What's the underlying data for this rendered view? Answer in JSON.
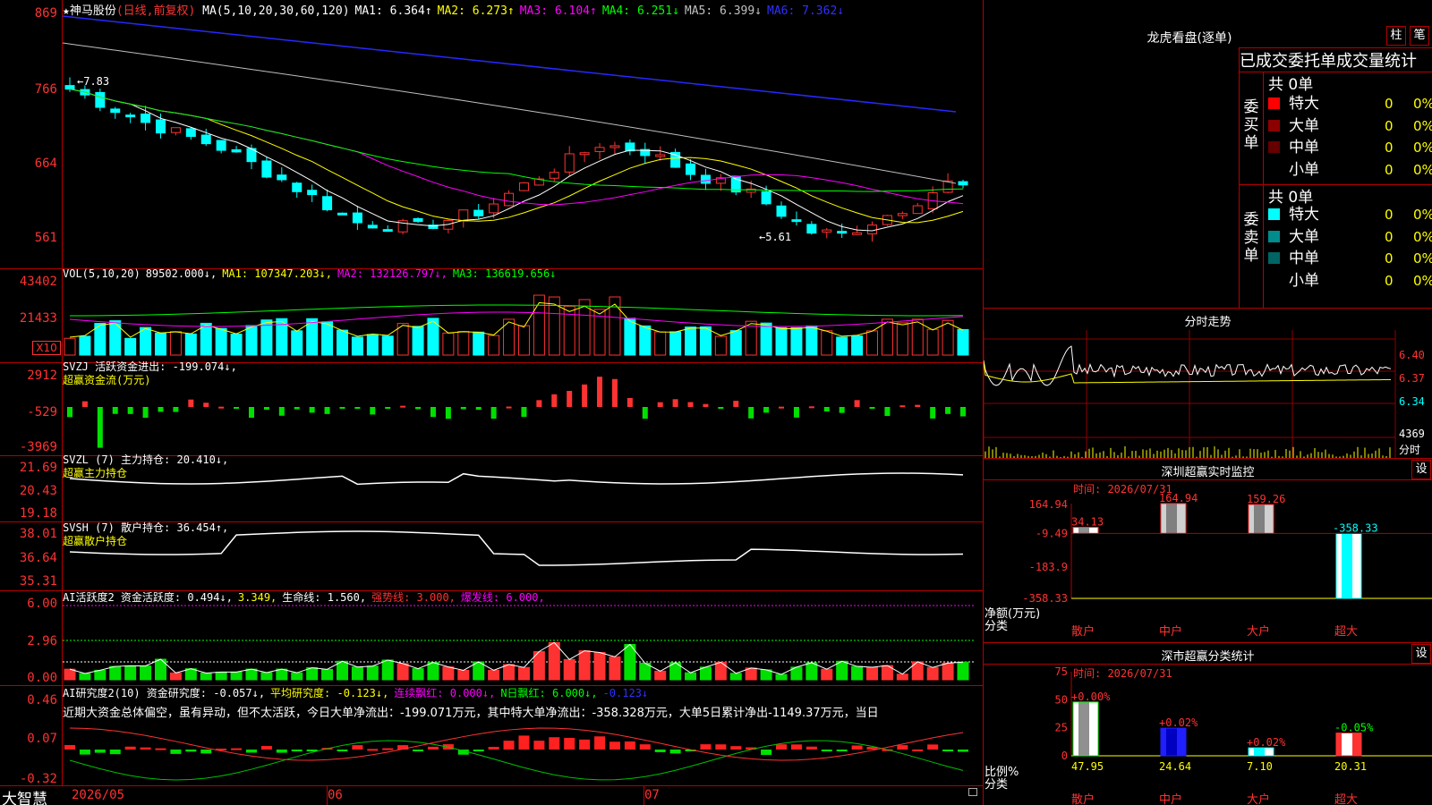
{
  "stock": {
    "star": "★",
    "name": "神马股份",
    "mode": "(日线,前复权)"
  },
  "ma_legend": [
    {
      "label": "MA(5,10,20,30,60,120)",
      "color": "#ffffff"
    },
    {
      "label": "MA1: 6.364↑",
      "color": "#ffffff"
    },
    {
      "label": "MA2: 6.273↑",
      "color": "#ffff00"
    },
    {
      "label": "MA3: 6.104↑",
      "color": "#ff00ff"
    },
    {
      "label": "MA4: 6.251↓",
      "color": "#00ff00"
    },
    {
      "label": "MA5: 6.399↓",
      "color": "#c0c0c0"
    },
    {
      "label": "MA6: 7.362↓",
      "color": "#3030ff"
    }
  ],
  "price_axis": [
    "869",
    "766",
    "664",
    "561"
  ],
  "price_annotations": {
    "high": "7.83",
    "low": "5.61"
  },
  "vol_legend": [
    {
      "label": "VOL(5,10,20)",
      "color": "#ffffff"
    },
    {
      "label": "89502.000↓,",
      "color": "#ffffff"
    },
    {
      "label": "MA1: 107347.203↓,",
      "color": "#ffff00"
    },
    {
      "label": "MA2: 132126.797↓,",
      "color": "#ff00ff"
    },
    {
      "label": "MA3: 136619.656↓",
      "color": "#00ff00"
    }
  ],
  "vol_axis": [
    "43402",
    "21433"
  ],
  "vol_unit": "X10",
  "svzj_legend": {
    "line1": "SVZJ  活跃资金进出: -199.074↓,",
    "line2": "超赢资金流(万元)"
  },
  "svzj_axis": [
    "2912",
    "-529",
    "-3969"
  ],
  "svzl_legend": {
    "line1": "SVZL (7) 主力持仓: 20.410↓,",
    "line2": "超赢主力持仓"
  },
  "svzl_axis": [
    "21.69",
    "20.43",
    "19.18"
  ],
  "svsh_legend": {
    "line1": "SVSH (7) 散户持仓: 36.454↑,",
    "line2": "超赢散户持仓"
  },
  "svsh_axis": [
    "38.01",
    "36.64",
    "35.31"
  ],
  "ai1_legend": [
    {
      "label": "AI活跃度2 资金活跃度: 0.494↓,",
      "color": "#ffffff"
    },
    {
      "label": "3.349,",
      "color": "#ffff00"
    },
    {
      "label": "生命线: 1.560,",
      "color": "#ffffff"
    },
    {
      "label": "强势线: 3.000,",
      "color": "#ff3232"
    },
    {
      "label": "爆发线: 6.000,",
      "color": "#ff00ff"
    }
  ],
  "ai1_axis": [
    "6.00",
    "2.96",
    "0.00"
  ],
  "ai2_legend": [
    {
      "label": "AI研究度2(10) 资金研究度: -0.057↓,",
      "color": "#ffffff"
    },
    {
      "label": "平均研究度: -0.123↓,",
      "color": "#ffff00"
    },
    {
      "label": "连续飘红: 0.000↓,",
      "color": "#ff00ff"
    },
    {
      "label": "N日飘红: 6.000↓,",
      "color": "#00ff00"
    },
    {
      "label": "-0.123↓",
      "color": "#3030ff"
    }
  ],
  "ai2_text": "近期大资金总体偏空，虽有异动，但不太活跃，今日大单净流出：-199.071万元，其中特大单净流出：-358.328万元，大单5日累计净出-1149.37万元，当日",
  "ai2_axis": [
    "0.46",
    "0.07",
    "-0.32"
  ],
  "date_axis": {
    "brand": "大智慧",
    "labels": [
      "2026/05",
      "06",
      "07"
    ]
  },
  "longhu": {
    "title": "龙虎看盘(逐单)",
    "btn1": "柱",
    "btn2": "笔",
    "subtitle": "已成交委托单成交量统计",
    "buy": {
      "side": "委买单",
      "total": "共 0单",
      "rows": [
        {
          "label": "特大",
          "color": "#ff0000",
          "count": "0",
          "pct": "0%"
        },
        {
          "label": "大单",
          "color": "#8c0000",
          "count": "0",
          "pct": "0%"
        },
        {
          "label": "中单",
          "color": "#640000",
          "count": "0",
          "pct": "0%"
        },
        {
          "label": "小单",
          "color": "#000000",
          "count": "0",
          "pct": "0%"
        }
      ]
    },
    "sell": {
      "side": "委卖单",
      "total": "共 0单",
      "rows": [
        {
          "label": "特大",
          "color": "#00ffff",
          "count": "0",
          "pct": "0%"
        },
        {
          "label": "大单",
          "color": "#008c8c",
          "count": "0",
          "pct": "0%"
        },
        {
          "label": "中单",
          "color": "#006464",
          "count": "0",
          "pct": "0%"
        },
        {
          "label": "小单",
          "color": "#000000",
          "count": "0",
          "pct": "0%"
        }
      ]
    }
  },
  "intraday": {
    "title": "分时走势",
    "axis": [
      "6.40",
      "6.37",
      "6.34"
    ],
    "vol_label": "4369",
    "vol_caption": "分时"
  },
  "monitor": {
    "title": "深圳超赢实时监控",
    "btn": "设",
    "time": "时间: 2026/07/31",
    "axis": [
      "164.94",
      "-9.49",
      "-183.9",
      "-358.33"
    ],
    "caption1": "净额(万元)",
    "caption2": "分类",
    "chart_data": {
      "type": "bar",
      "categories": [
        "散户",
        "中户",
        "大户",
        "超大"
      ],
      "values": [
        34.13,
        164.94,
        159.26,
        -358.33
      ],
      "ylim": [
        -358.33,
        164.94
      ]
    }
  },
  "classify": {
    "title": "深市超赢分类统计",
    "btn": "设",
    "time": "时间: 2026/07/31",
    "axis": [
      "75",
      "50",
      "25",
      "0"
    ],
    "caption1": "比例%",
    "caption2": "分类",
    "chart_data": {
      "type": "bar",
      "categories": [
        "散户",
        "中户",
        "大户",
        "超大"
      ],
      "values": [
        47.95,
        24.64,
        7.1,
        20.31
      ],
      "changes": [
        "+0.00%",
        "+0.02%",
        "+0.02%",
        "-0.05%"
      ],
      "ylim": [
        0,
        75
      ]
    }
  }
}
